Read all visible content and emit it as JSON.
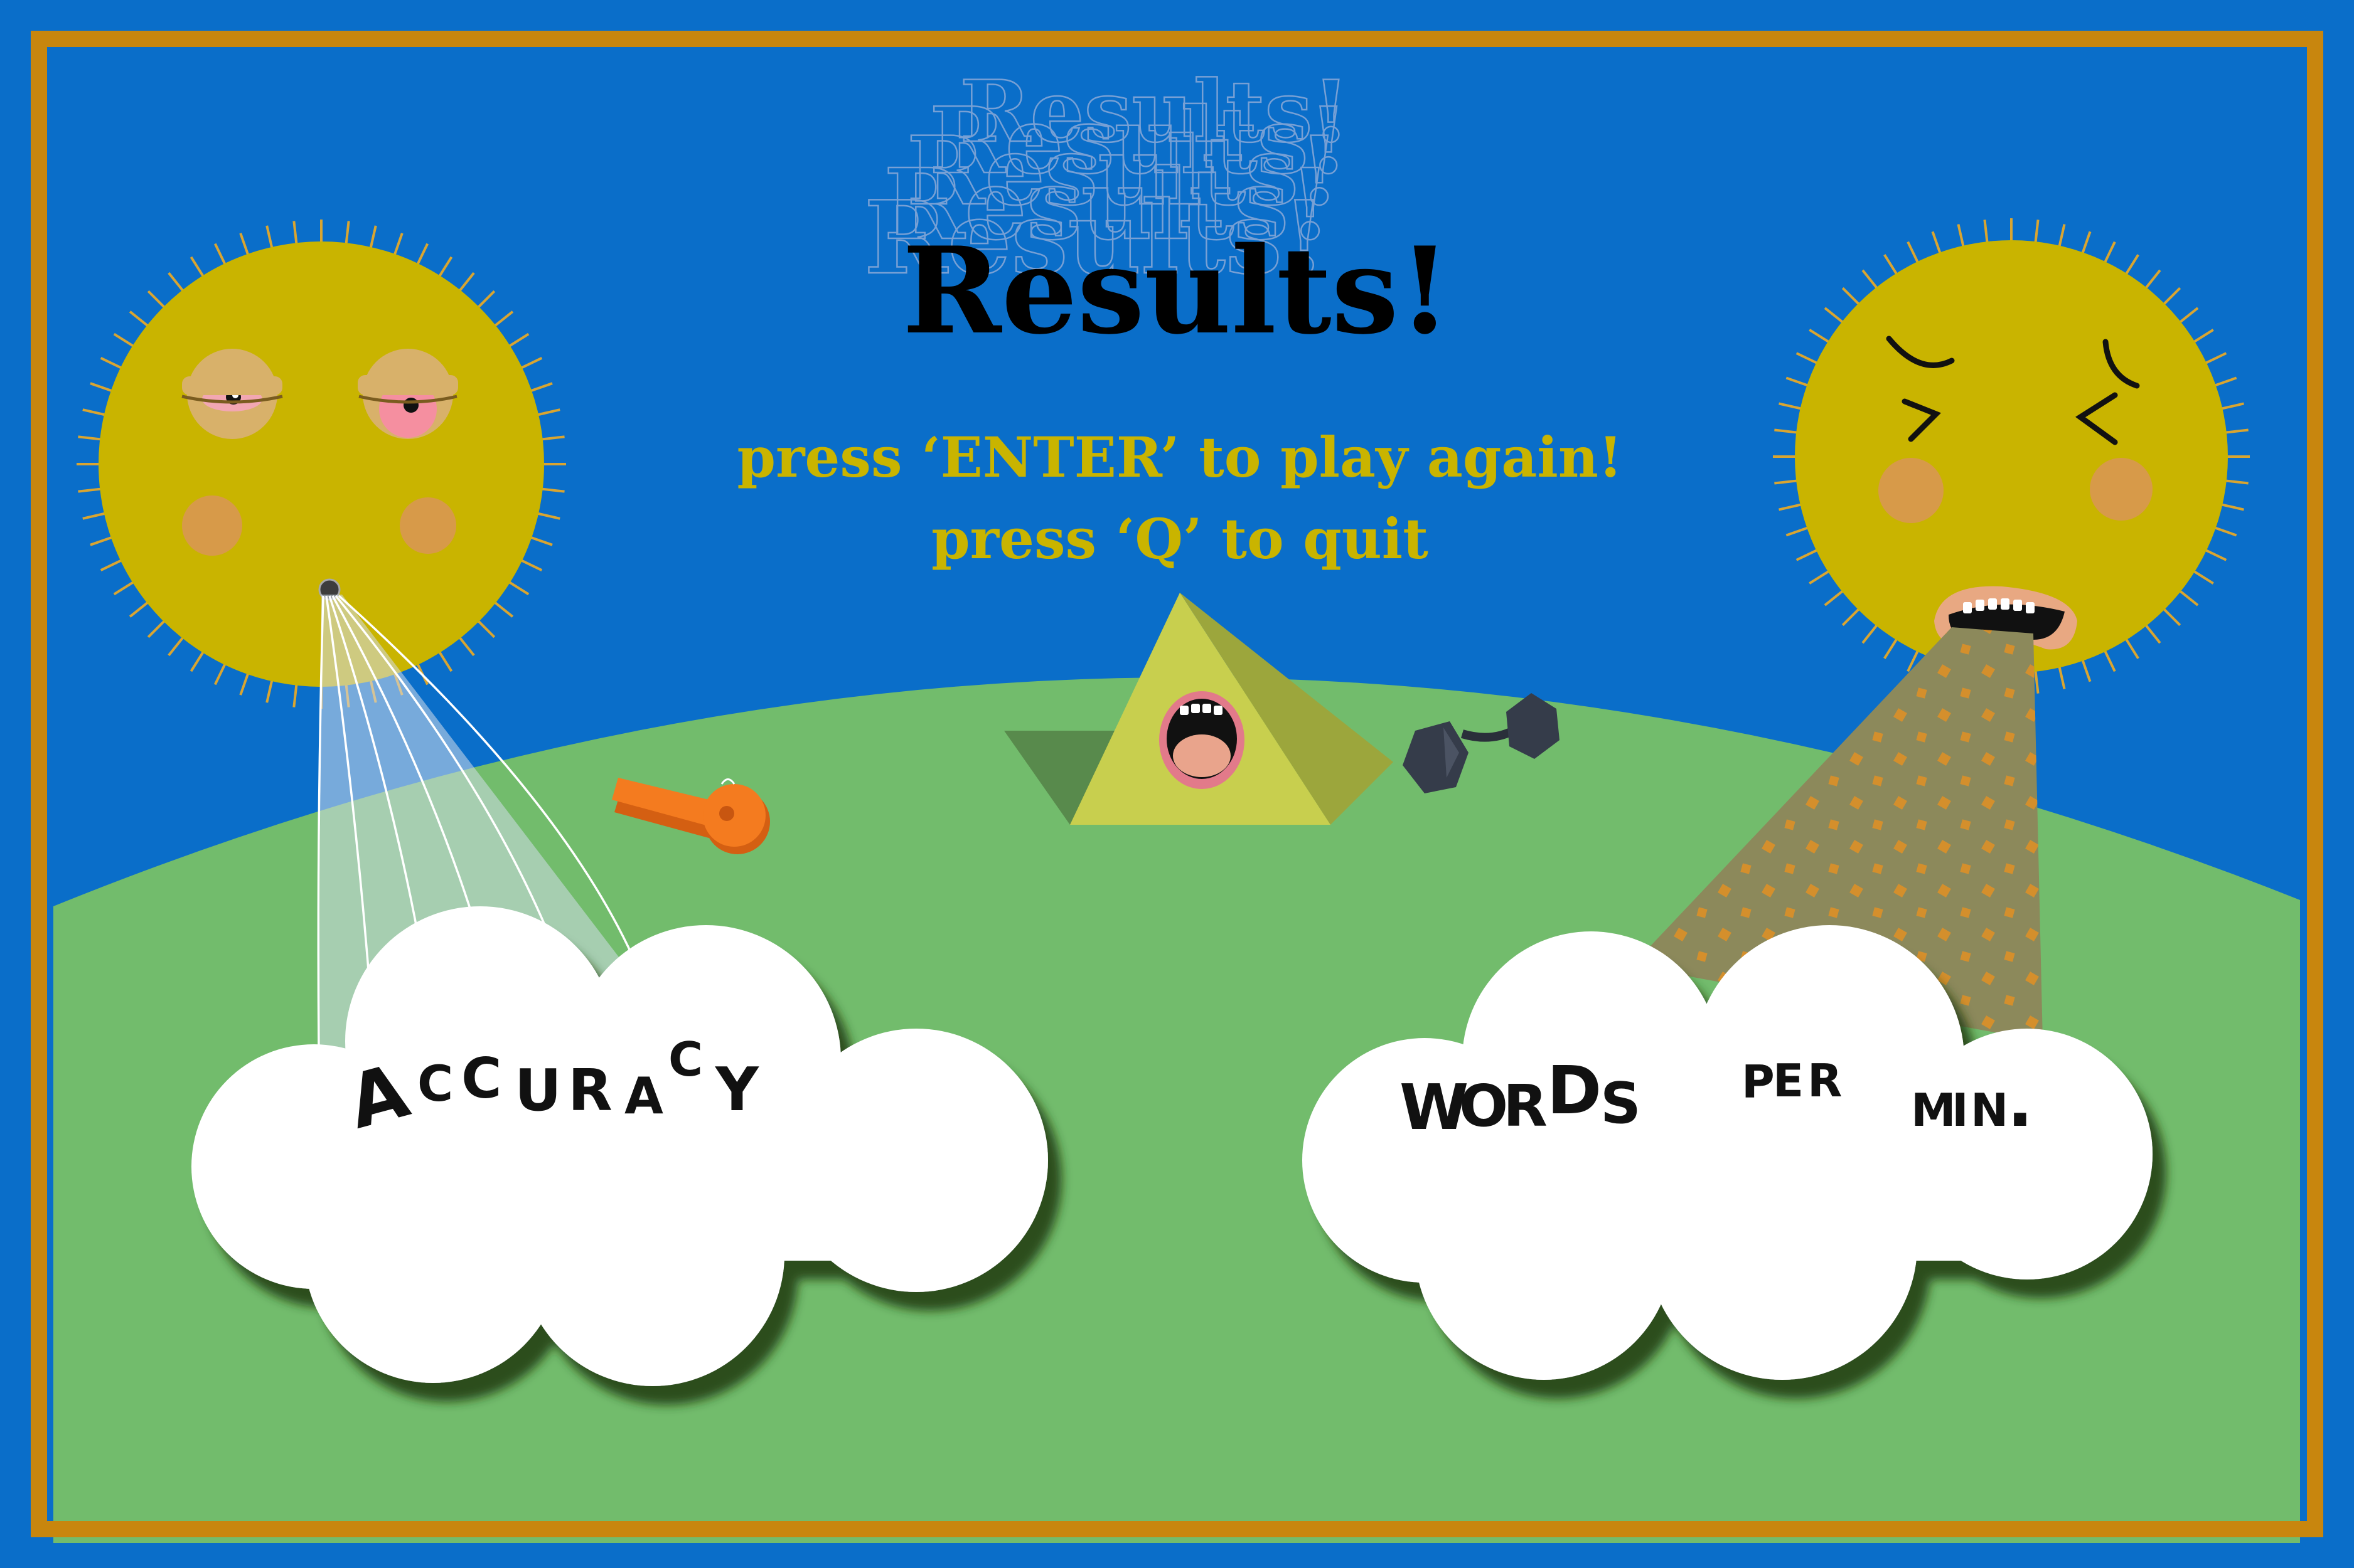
{
  "screen": {
    "title": "Results!",
    "instructions": {
      "line1": "press ‘ENTER’ to play again!",
      "line2": "press ‘Q’ to quit"
    }
  },
  "clouds": {
    "left": {
      "label": "ACCURACY",
      "letters": [
        "A",
        "C",
        "C",
        "U",
        "R",
        "A",
        "C",
        "Y"
      ]
    },
    "right": {
      "label": "WORDS PER MIN.",
      "letters": [
        "W",
        "O",
        "R",
        "D",
        "S",
        "P",
        "E",
        "R",
        "M",
        "I",
        "N",
        "."
      ]
    }
  },
  "icons": {
    "left_sun": "sleepy-sun-icon",
    "right_sun": "crying-sun-icon",
    "pyramid": "shouting-pyramid-icon",
    "whistle": "whistle-icon",
    "dumbbell": "dumbbell-icon"
  },
  "colors": {
    "sky": "#0a6ec9",
    "frame": "#c8860e",
    "grass": "#72bc6c",
    "sun": "#c9b400",
    "sun_ray": "#d9a531",
    "instruction_text": "#c9b400",
    "title_text": "#000000",
    "cloud": "#ffffff",
    "pyramid": "#c8cf4e",
    "whistle": "#f47b1f",
    "dumbbell": "#353c4a"
  }
}
